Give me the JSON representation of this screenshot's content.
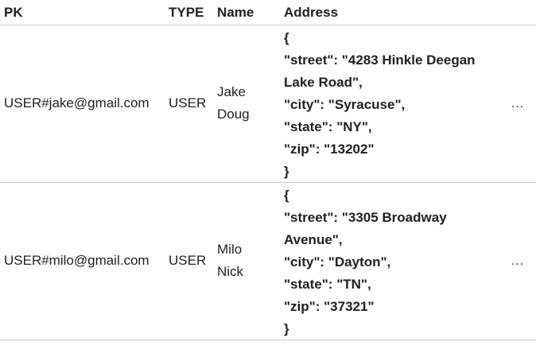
{
  "headers": {
    "pk": "PK",
    "type": "TYPE",
    "name": "Name",
    "address": "Address"
  },
  "rows": [
    {
      "pk": "USER#jake@gmail.com",
      "type": "USER",
      "name_line1": "Jake",
      "name_line2": "Doug",
      "address_lines": [
        "{",
        "\"street\": \"4283 Hinkle Deegan",
        "Lake Road\",",
        "\"city\": \"Syracuse\",",
        "\"state\": \"NY\",",
        "\"zip\": \"13202\"",
        "}"
      ],
      "more": "…"
    },
    {
      "pk": "USER#milo@gmail.com",
      "type": "USER",
      "name_line1": "Milo",
      "name_line2": "Nick",
      "address_lines": [
        "{",
        "\"street\": \"3305 Broadway",
        "Avenue\",",
        "\"city\": \"Dayton\",",
        "\"state\": \"TN\",",
        "\"zip\": \"37321\"",
        "}"
      ],
      "more": "…"
    }
  ]
}
